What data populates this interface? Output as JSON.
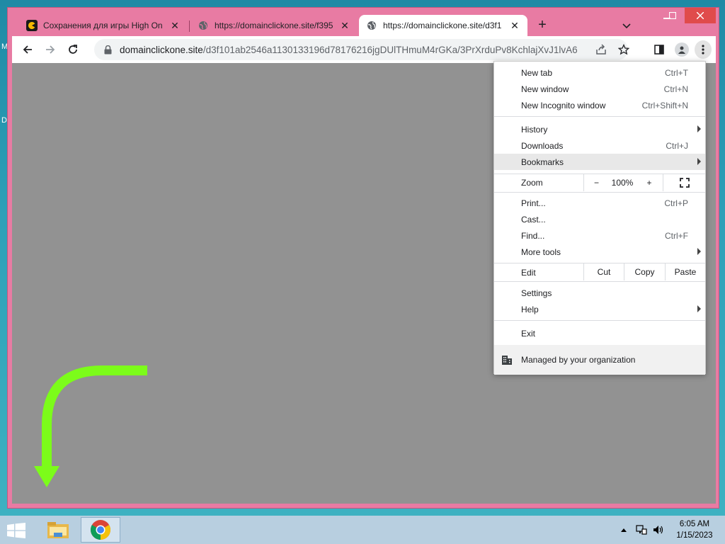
{
  "desktop": {
    "edge_letters": [
      "M",
      "D"
    ]
  },
  "browser": {
    "tabs": [
      {
        "title": "Сохранения для игры High On L",
        "favicon": "pacman-icon",
        "active": false
      },
      {
        "title": "https://domainclickone.site/f395",
        "favicon": "globe-icon",
        "active": false
      },
      {
        "title": "https://domainclickone.site/d3f1",
        "favicon": "globe-icon",
        "active": true
      }
    ],
    "new_tab_symbol": "+",
    "address": {
      "host": "domainclickone.site",
      "path": "/d3f101ab2546a1130133196d78176216jgDUlTHmuM4rGKa/3PrXrduPv8KchlajXvJ1lvA6"
    }
  },
  "menu": {
    "items": [
      {
        "label": "New tab",
        "shortcut": "Ctrl+T"
      },
      {
        "label": "New window",
        "shortcut": "Ctrl+N"
      },
      {
        "label": "New Incognito window",
        "shortcut": "Ctrl+Shift+N"
      },
      {
        "label": "History",
        "shortcut": ""
      },
      {
        "label": "Downloads",
        "shortcut": "Ctrl+J"
      },
      {
        "label": "Bookmarks",
        "shortcut": ""
      },
      {
        "label": "Print...",
        "shortcut": "Ctrl+P"
      },
      {
        "label": "Cast...",
        "shortcut": ""
      },
      {
        "label": "Find...",
        "shortcut": "Ctrl+F"
      },
      {
        "label": "More tools",
        "shortcut": ""
      },
      {
        "label": "Settings",
        "shortcut": ""
      },
      {
        "label": "Help",
        "shortcut": ""
      },
      {
        "label": "Exit",
        "shortcut": ""
      }
    ],
    "zoom": {
      "label": "Zoom",
      "minus": "−",
      "value": "100%",
      "plus": "+"
    },
    "edit": {
      "label": "Edit",
      "cut": "Cut",
      "copy": "Copy",
      "paste": "Paste"
    },
    "managed": "Managed by your organization",
    "highlighted": "Bookmarks"
  },
  "taskbar": {
    "time": "6:05 AM",
    "date": "1/15/2023"
  },
  "colors": {
    "window_frame": "#e87ba3",
    "page_background": "#929292",
    "arrow": "#7cfc1a",
    "close_button": "#e04b4b"
  }
}
